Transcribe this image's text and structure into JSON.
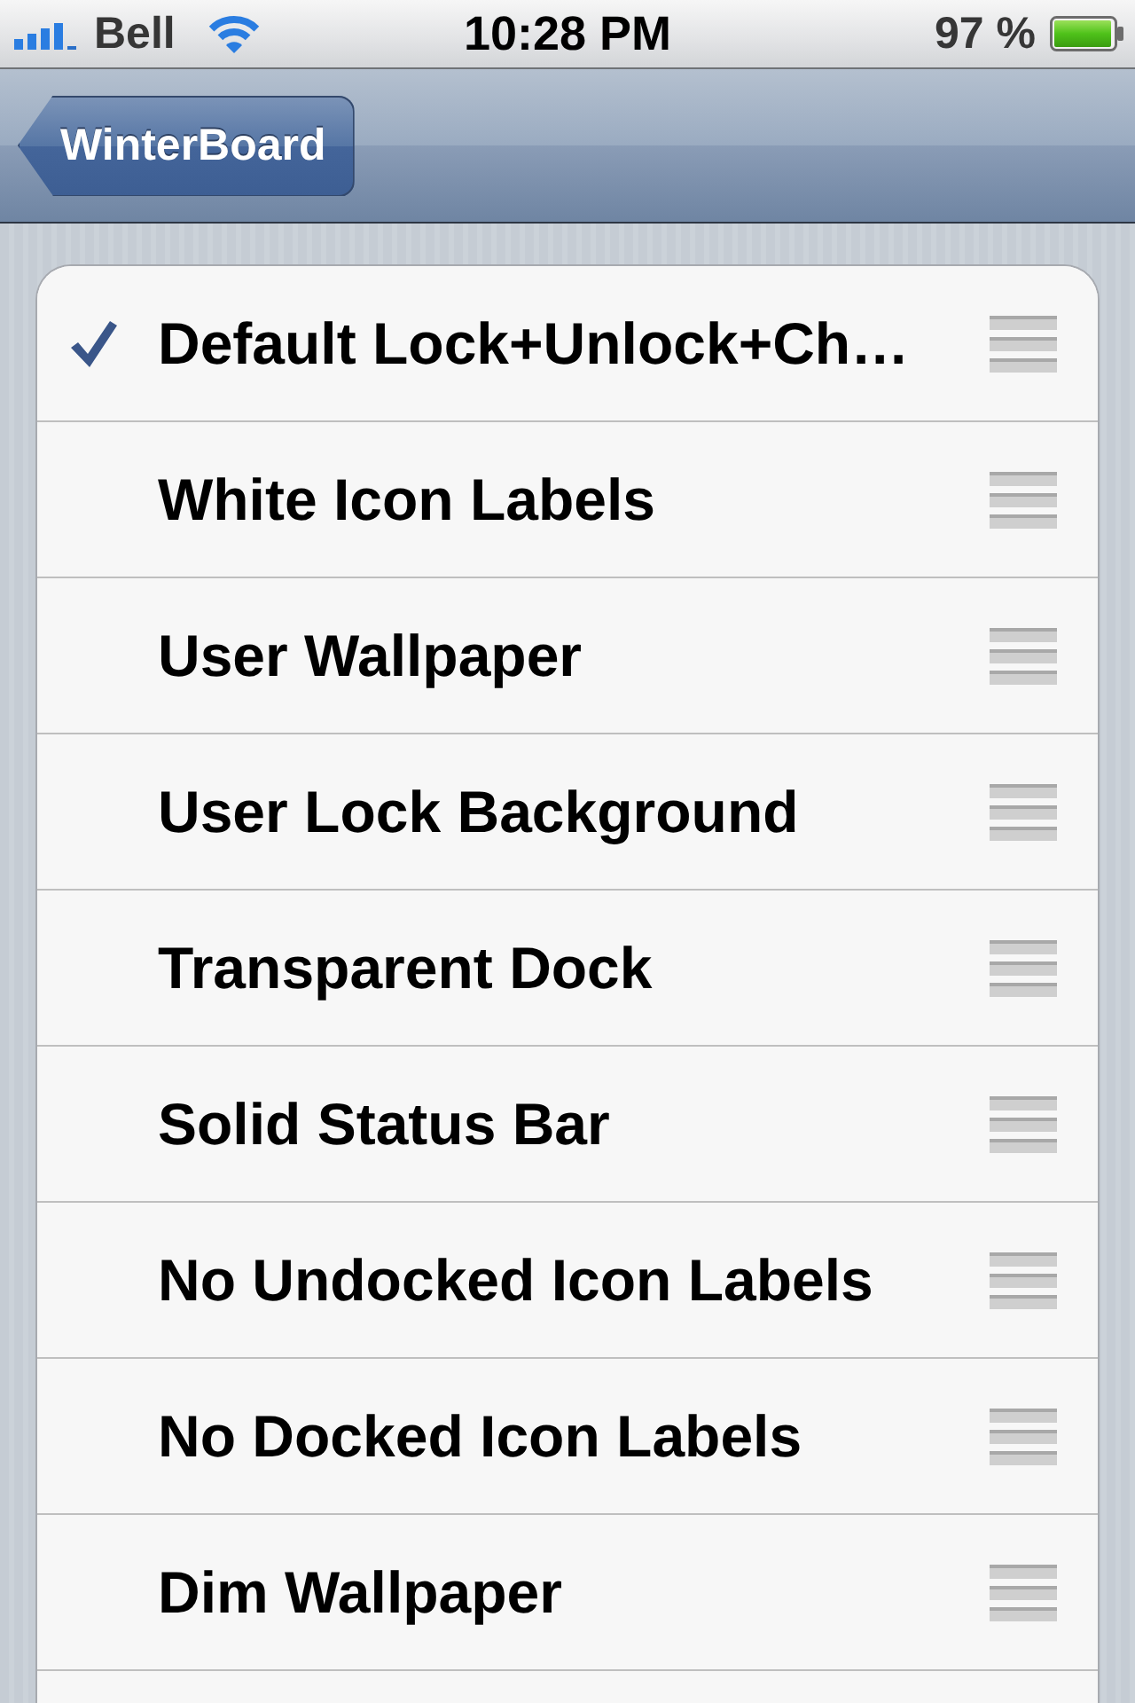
{
  "status_bar": {
    "carrier": "Bell",
    "time": "10:28 PM",
    "battery": "97 %"
  },
  "nav_bar": {
    "back_button": "WinterBoard"
  },
  "themes": [
    {
      "name": "Default Lock+Unlock+Ch…",
      "checked": true
    },
    {
      "name": "White Icon Labels",
      "checked": false
    },
    {
      "name": "User Wallpaper",
      "checked": false
    },
    {
      "name": "User Lock Background",
      "checked": false
    },
    {
      "name": "Transparent Dock",
      "checked": false
    },
    {
      "name": "Solid Status Bar",
      "checked": false
    },
    {
      "name": "No Undocked Icon Labels",
      "checked": false
    },
    {
      "name": "No Docked Icon Labels",
      "checked": false
    },
    {
      "name": "Dim Wallpaper",
      "checked": false
    }
  ]
}
